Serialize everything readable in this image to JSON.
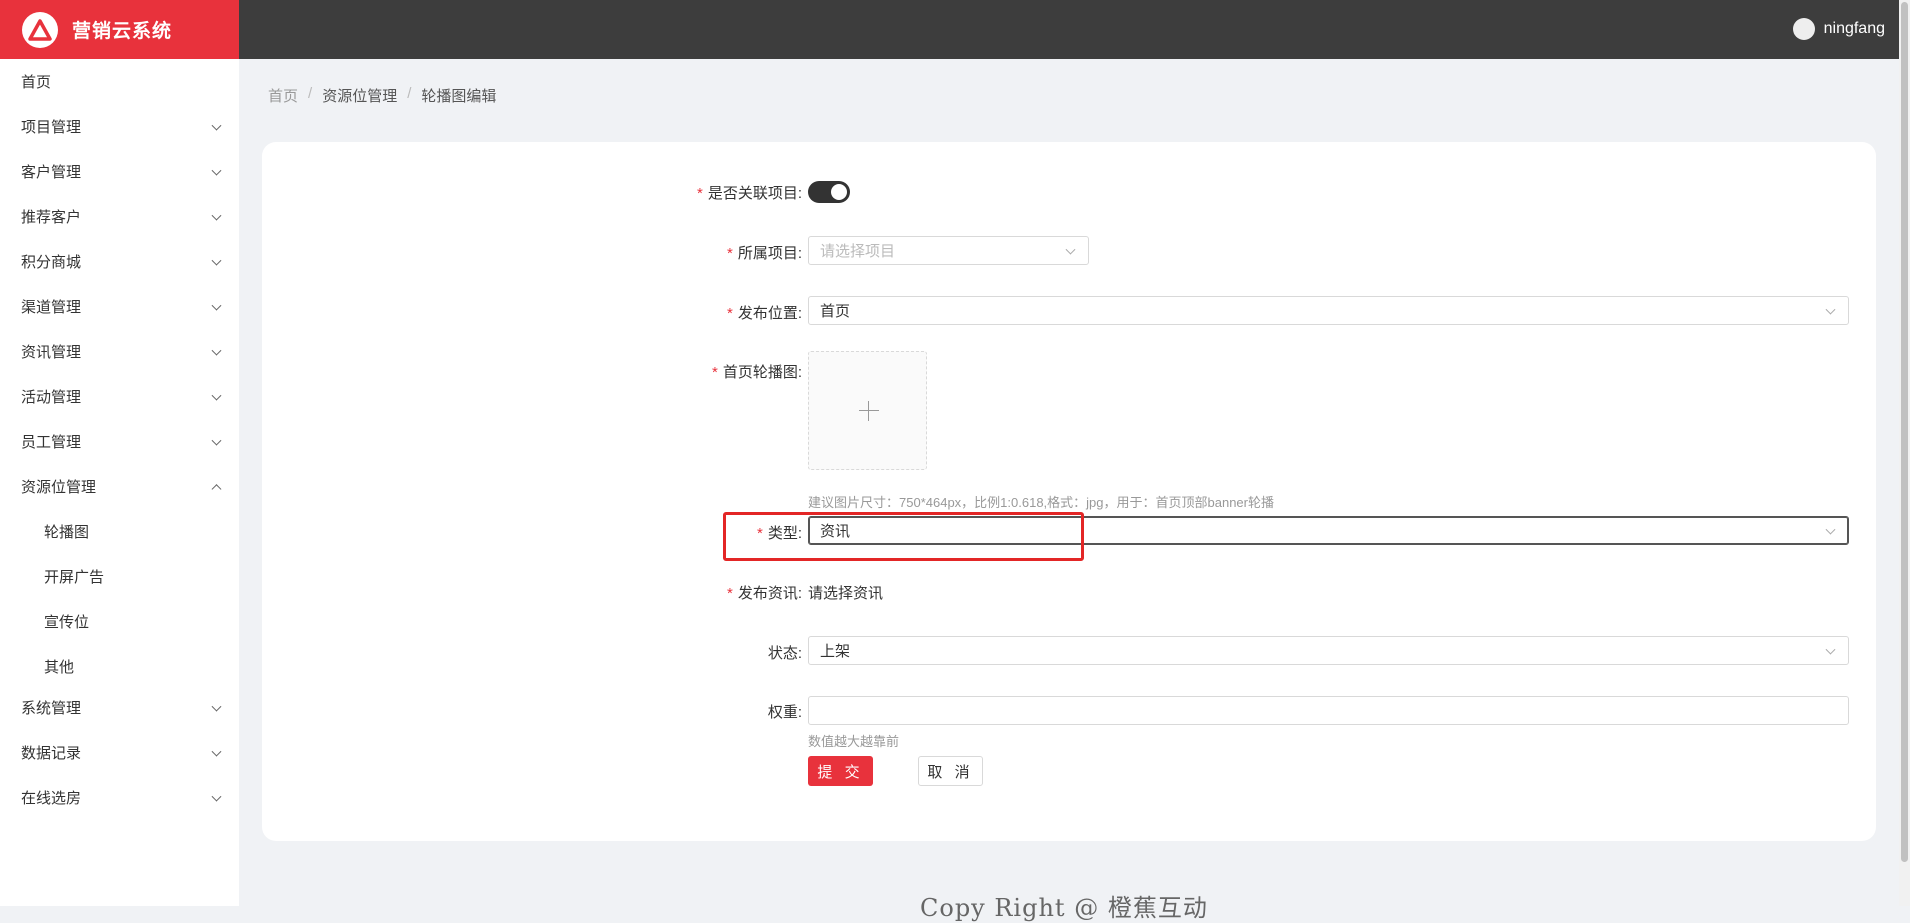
{
  "app": {
    "title": "营销云系统",
    "brand_color": "#e8323c"
  },
  "user": {
    "name": "ningfang"
  },
  "sidebar": {
    "items": [
      {
        "label": "首页",
        "expandable": false
      },
      {
        "label": "项目管理",
        "expandable": true
      },
      {
        "label": "客户管理",
        "expandable": true
      },
      {
        "label": "推荐客户",
        "expandable": true
      },
      {
        "label": "积分商城",
        "expandable": true
      },
      {
        "label": "渠道管理",
        "expandable": true
      },
      {
        "label": "资讯管理",
        "expandable": true
      },
      {
        "label": "活动管理",
        "expandable": true
      },
      {
        "label": "员工管理",
        "expandable": true
      },
      {
        "label": "资源位管理",
        "expandable": true,
        "expanded": true
      },
      {
        "label": "轮播图",
        "sub": true
      },
      {
        "label": "开屏广告",
        "sub": true
      },
      {
        "label": "宣传位",
        "sub": true
      },
      {
        "label": "其他",
        "sub": true
      },
      {
        "label": "系统管理",
        "expandable": true
      },
      {
        "label": "数据记录",
        "expandable": true
      },
      {
        "label": "在线选房",
        "expandable": true
      }
    ]
  },
  "breadcrumb": {
    "items": [
      "首页",
      "资源位管理",
      "轮播图编辑"
    ],
    "separator": "/"
  },
  "form": {
    "link_project": {
      "label": "是否关联项目:",
      "required": true,
      "value": true
    },
    "project": {
      "label": "所属项目:",
      "required": true,
      "placeholder": "请选择项目"
    },
    "position": {
      "label": "发布位置:",
      "required": true,
      "value": "首页"
    },
    "banner": {
      "label": "首页轮播图:",
      "required": true,
      "hint": "建议图片尺寸：750*464px，比例1:0.618,格式：jpg，用于：首页顶部banner轮播"
    },
    "type": {
      "label": "类型:",
      "required": true,
      "value": "资讯"
    },
    "article": {
      "label": "发布资讯:",
      "required": true,
      "value": "请选择资讯"
    },
    "status": {
      "label": "状态:",
      "required": false,
      "value": "上架"
    },
    "weight": {
      "label": "权重:",
      "required": false,
      "value": "",
      "hint": "数值越大越靠前"
    },
    "submit_label": "提 交",
    "cancel_label": "取 消"
  },
  "footer": {
    "text": "Copy Right @ 橙蕉互动"
  }
}
